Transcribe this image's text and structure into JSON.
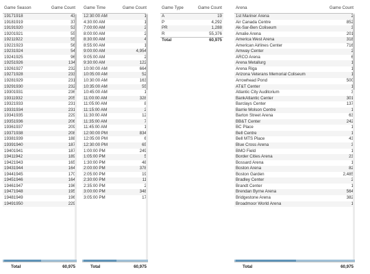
{
  "season_table": {
    "headers": [
      "Game Season",
      "Game Count"
    ],
    "rows": [
      [
        "19171918",
        "43"
      ],
      [
        "19181919",
        "37"
      ],
      [
        "19191920",
        "53"
      ],
      [
        "19201921",
        "55"
      ],
      [
        "19211922",
        "55"
      ],
      [
        "19221923",
        "56"
      ],
      [
        "19231924",
        "54"
      ],
      [
        "19241925",
        "96"
      ],
      [
        "19251926",
        "134"
      ],
      [
        "19261927",
        "232"
      ],
      [
        "19271928",
        "233"
      ],
      [
        "19281929",
        "231"
      ],
      [
        "19291930",
        "232"
      ],
      [
        "19301931",
        "236"
      ],
      [
        "19311932",
        "205"
      ],
      [
        "19321933",
        "231"
      ],
      [
        "19331934",
        "231"
      ],
      [
        "19341935",
        "229"
      ],
      [
        "19351936",
        "206"
      ],
      [
        "19361937",
        "209"
      ],
      [
        "19371938",
        "208"
      ],
      [
        "19381939",
        "188"
      ],
      [
        "19391940",
        "187"
      ],
      [
        "19401941",
        "187"
      ],
      [
        "19411942",
        "189"
      ],
      [
        "19421943",
        "165"
      ],
      [
        "19431944",
        "164"
      ],
      [
        "19441945",
        "170"
      ],
      [
        "19451946",
        "164"
      ],
      [
        "19461947",
        "196"
      ],
      [
        "19471948",
        "195"
      ],
      [
        "19481949",
        "196"
      ],
      [
        "19491950",
        "229"
      ]
    ],
    "total_label": "Total",
    "total_value": "60,975"
  },
  "time_table": {
    "headers": [
      "Game Time",
      "Game Count"
    ],
    "rows": [
      [
        "12:30:00 AM",
        "1"
      ],
      [
        "4:30:00 AM",
        "1"
      ],
      [
        "7:00:00 AM",
        "2"
      ],
      [
        "8:00:00 AM",
        "2"
      ],
      [
        "8:30:00 AM",
        "4"
      ],
      [
        "8:55:00 AM",
        "1"
      ],
      [
        "9:00:00 AM",
        "4,954"
      ],
      [
        "9:05:00 AM",
        "2"
      ],
      [
        "9:30:00 AM",
        "122"
      ],
      [
        "10:00:00 AM",
        "664"
      ],
      [
        "10:05:00 AM",
        "52"
      ],
      [
        "10:30:00 AM",
        "163"
      ],
      [
        "10:35:00 AM",
        "55"
      ],
      [
        "10:45:00 AM",
        "1"
      ],
      [
        "11:00:00 AM",
        "328"
      ],
      [
        "11:05:00 AM",
        "8"
      ],
      [
        "11:15:00 AM",
        "2"
      ],
      [
        "11:30:00 AM",
        "12"
      ],
      [
        "11:35:00 AM",
        "7"
      ],
      [
        "11:45:00 AM",
        "1"
      ],
      [
        "12:00:00 PM",
        "834"
      ],
      [
        "12:05:00 PM",
        "6"
      ],
      [
        "12:30:00 PM",
        "65"
      ],
      [
        "1:00:00 PM",
        "249"
      ],
      [
        "1:05:00 PM",
        "5"
      ],
      [
        "1:30:00 PM",
        "48"
      ],
      [
        "2:00:00 PM",
        "378"
      ],
      [
        "2:05:00 PM",
        "19"
      ],
      [
        "2:30:00 PM",
        "11"
      ],
      [
        "2:35:00 PM",
        "2"
      ],
      [
        "3:00:00 PM",
        "348"
      ],
      [
        "3:05:00 PM",
        "17"
      ]
    ],
    "total_label": "Total",
    "total_value": "60,975"
  },
  "type_table": {
    "headers": [
      "Game Type",
      "Game Count"
    ],
    "rows": [
      [
        "A",
        "19"
      ],
      [
        "P",
        "4,292"
      ],
      [
        "PR",
        "1,288"
      ],
      [
        "R",
        "55,376"
      ]
    ],
    "total_label": "Total",
    "total_value": "60,975"
  },
  "arena_table": {
    "headers": [
      "Arena",
      "Game Count"
    ],
    "rows": [
      [
        "1st Mariner Arena",
        "2"
      ],
      [
        "Air Canada Centre",
        "852"
      ],
      [
        "Ak-Sar-Ben Coliseum",
        "3"
      ],
      [
        "Amalie Arena",
        "201"
      ],
      [
        "America West Arena",
        "318"
      ],
      [
        "American Airlines Center",
        "716"
      ],
      [
        "Amway Center",
        "2"
      ],
      [
        "ARCO Arena",
        "6"
      ],
      [
        "Arena Metallurg",
        "1"
      ],
      [
        "Arena Riga",
        "1"
      ],
      [
        "Arizona Veterans Memorial Coliseum",
        "1"
      ],
      [
        "Arrowhead Pond",
        "500"
      ],
      [
        "AT&T Center",
        "1"
      ],
      [
        "Atlantic City Auditorium",
        "3"
      ],
      [
        "BankAtlantic Center",
        "301"
      ],
      [
        "Barclays Center",
        "137"
      ],
      [
        "Barrie Molson Centre",
        "1"
      ],
      [
        "Barton Street Arena",
        "63"
      ],
      [
        "BB&T Center",
        "242"
      ],
      [
        "BC Place",
        "1"
      ],
      [
        "Bell Centre",
        "1"
      ],
      [
        "Bell MTS Place",
        "43"
      ],
      [
        "Blue Cross Arena",
        "3"
      ],
      [
        "BMO Field",
        "1"
      ],
      [
        "Border Cities Arena",
        "23"
      ],
      [
        "Bossard Arena",
        "1"
      ],
      [
        "Boston Arena",
        "82"
      ],
      [
        "Boston Garden",
        "2,485"
      ],
      [
        "Bradley Center",
        "2"
      ],
      [
        "Brandt Center",
        "1"
      ],
      [
        "Brendan Byrne Arena",
        "564"
      ],
      [
        "Bridgestone Arena",
        "382"
      ],
      [
        "Broadmoor World Arena",
        "1"
      ]
    ],
    "total_label": "Total",
    "total_value": "60,975"
  }
}
